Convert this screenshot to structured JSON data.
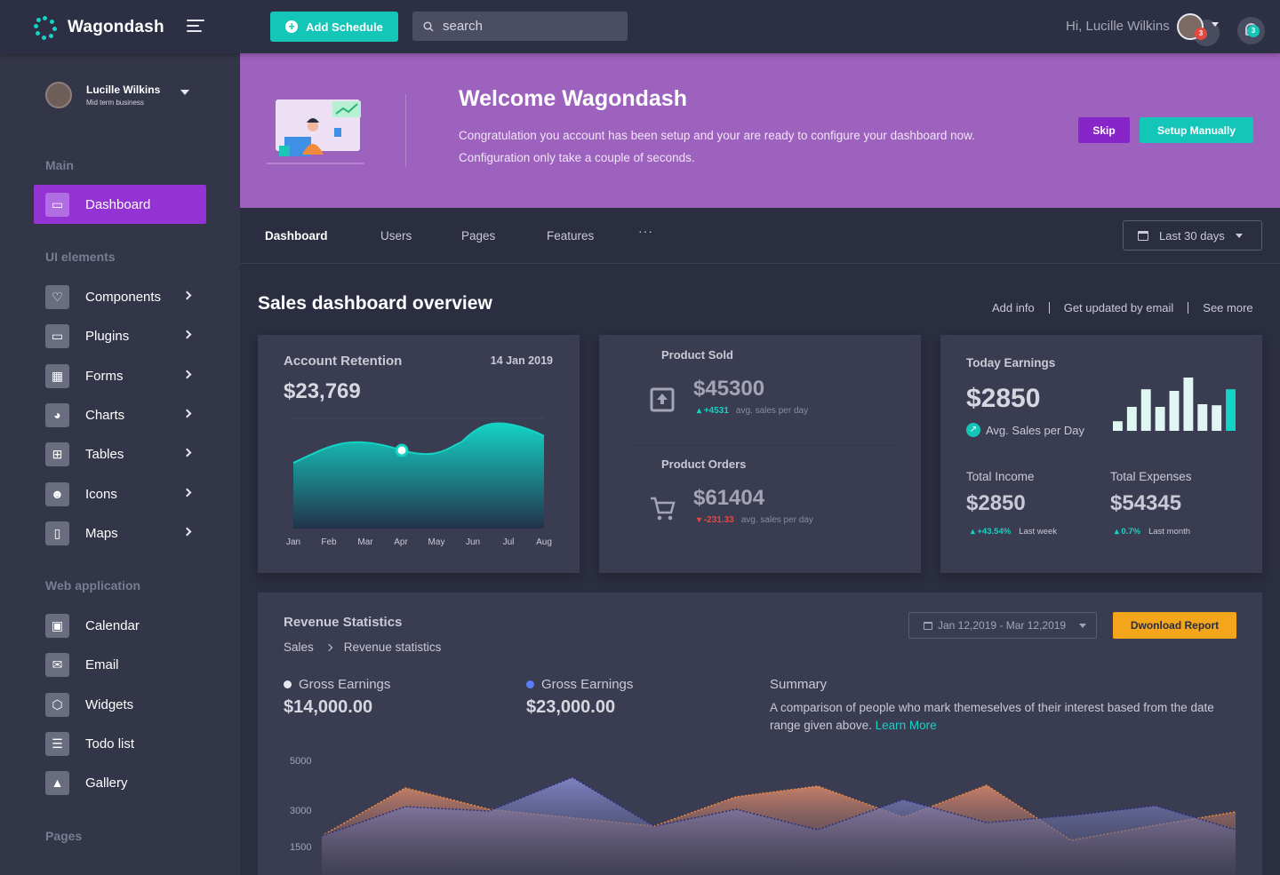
{
  "app": {
    "name": "Wagondash"
  },
  "topbar": {
    "add_schedule_label": "Add Schedule",
    "search_placeholder": "search",
    "greeting": "Hi, Lucille Wilkins",
    "avatar_badge": "3",
    "notif_badge": "3"
  },
  "sidebar": {
    "user": {
      "name": "Lucille Wilkins",
      "role": "Mid term business"
    },
    "sections": {
      "main": "Main",
      "ui": "UI elements",
      "web": "Web application",
      "pages": "Pages"
    },
    "items": {
      "dashboard": "Dashboard",
      "components": "Components",
      "plugins": "Plugins",
      "forms": "Forms",
      "charts": "Charts",
      "tables": "Tables",
      "icons": "Icons",
      "maps": "Maps",
      "calendar": "Calendar",
      "email": "Email",
      "widgets": "Widgets",
      "todo": "Todo list",
      "gallery": "Gallery"
    }
  },
  "banner": {
    "title": "Welcome Wagondash",
    "text": "Congratulation you account has been setup and your are ready to configure your dashboard now. Configuration only take a couple of seconds.",
    "skip_label": "Skip",
    "setup_label": "Setup Manually"
  },
  "tabs": {
    "dashboard": "Dashboard",
    "users": "Users",
    "pages": "Pages",
    "features": "Features",
    "more": "···",
    "range": "Last 30 days"
  },
  "overview": {
    "title": "Sales dashboard overview",
    "links": {
      "add_info": "Add info",
      "updates": "Get updated by email",
      "see_more": "See more"
    }
  },
  "retention": {
    "title": "Account Retention",
    "date": "14 Jan 2019",
    "value": "$23,769",
    "months": [
      "Jan",
      "Feb",
      "Mar",
      "Apr",
      "May",
      "Jun",
      "Jul",
      "Aug"
    ]
  },
  "product": {
    "sold_label": "Product Sold",
    "sold_value": "$45300",
    "sold_change": "+4531",
    "sold_note": "avg. sales per day",
    "orders_label": "Product Orders",
    "orders_value": "$61404",
    "orders_change": "-231.33",
    "orders_note": "avg. sales per day"
  },
  "earnings": {
    "title": "Today Earnings",
    "value": "$2850",
    "avg_label": "Avg. Sales per Day",
    "bars": [
      0.18,
      0.45,
      0.78,
      0.45,
      0.75,
      1.0,
      0.5,
      0.48,
      0.78
    ],
    "income_label": "Total Income",
    "income_value": "$2850",
    "income_change": "+43.54%",
    "income_period": "Last week",
    "expenses_label": "Total Expenses",
    "expenses_value": "$54345",
    "expenses_change": "0.7%",
    "expenses_period": "Last month"
  },
  "revenue": {
    "title": "Revenue Statistics",
    "crumb_root": "Sales",
    "crumb_leaf": "Revenue statistics",
    "date_range": "Jan 12,2019 - Mar 12,2019",
    "download_label": "Dwonload Report",
    "gross1_label": "Gross Earnings",
    "gross1_value": "$14,000.00",
    "gross2_label": "Gross Earnings",
    "gross2_value": "$23,000.00",
    "summary_title": "Summary",
    "summary_text": "A comparison of people who mark themeselves of their interest based from the date range given above.",
    "summary_link": "Learn More",
    "y_ticks": [
      "5000",
      "3000",
      "1500"
    ]
  },
  "colors": {
    "accent_teal": "#14c6b8",
    "accent_purple": "#9333d3",
    "banner": "#9d61be",
    "orange": "#f3a61c"
  }
}
